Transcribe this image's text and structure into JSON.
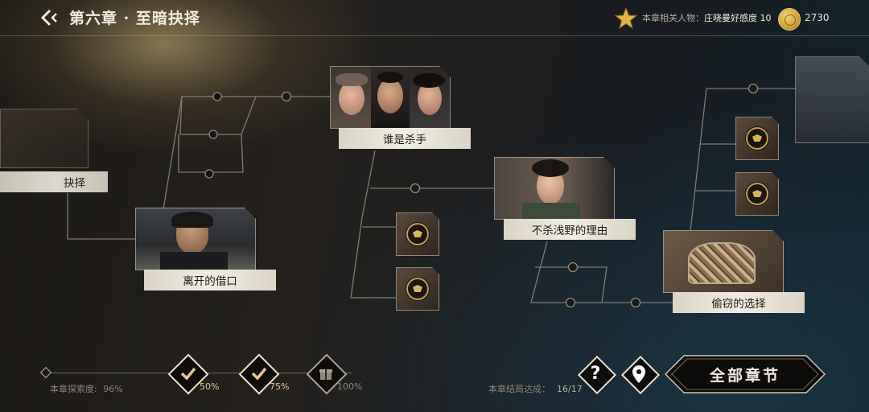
{
  "header": {
    "chapter_title": "第六章 · 至暗抉择",
    "related_label": "本章相关人物：",
    "related_value": "庄晓曼好感度 10",
    "coins": "2730"
  },
  "story_nodes": [
    {
      "id": "prev",
      "label": "抉择"
    },
    {
      "id": "leave",
      "label": "离开的借口"
    },
    {
      "id": "killer",
      "label": "谁是杀手"
    },
    {
      "id": "spare",
      "label": "不杀浅野的理由"
    },
    {
      "id": "theft",
      "label": "偷窃的选择"
    }
  ],
  "progress": {
    "explore_label": "本章探索度:",
    "explore_value": "96%",
    "milestones": [
      {
        "label": "50%",
        "icon": "check-icon",
        "state": "claimed"
      },
      {
        "label": "75%",
        "icon": "check-icon",
        "state": "claimed"
      },
      {
        "label": "100%",
        "icon": "gift-icon",
        "state": "locked"
      }
    ],
    "ending_label": "本章结局达成：",
    "ending_value": "16/17"
  },
  "buttons": {
    "all_chapters": "全部章节",
    "help": "?"
  },
  "colors": {
    "accent_gold": "#e2c98c",
    "label_bg": "#f1ede3",
    "line": "#8f8a80"
  }
}
